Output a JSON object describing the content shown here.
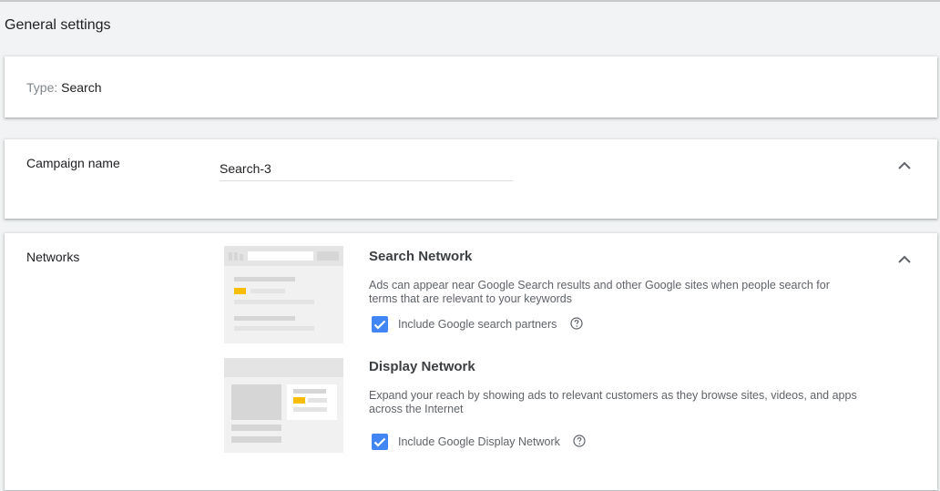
{
  "page_title": "General settings",
  "type_card": {
    "label": "Type:",
    "value": "Search"
  },
  "campaign_name": {
    "label": "Campaign name",
    "value": "Search-3"
  },
  "networks": {
    "label": "Networks",
    "search_network": {
      "title": "Search Network",
      "description": "Ads can appear near Google Search results and other Google sites when people search for terms that are relevant to your keywords",
      "checkbox_label": "Include Google search partners",
      "checked": true
    },
    "display_network": {
      "title": "Display Network",
      "description": "Expand your reach by showing ads to relevant customers as they browse sites, videos, and apps across the Internet",
      "checkbox_label": "Include Google Display Network",
      "checked": true
    }
  },
  "colors": {
    "checkbox": "#4285f4",
    "accent_yellow": "#fbbc04",
    "background": "#f1f3f4"
  },
  "icons": {
    "collapse": "chevron-up-icon",
    "help": "help-circle-icon",
    "check": "check-icon"
  }
}
